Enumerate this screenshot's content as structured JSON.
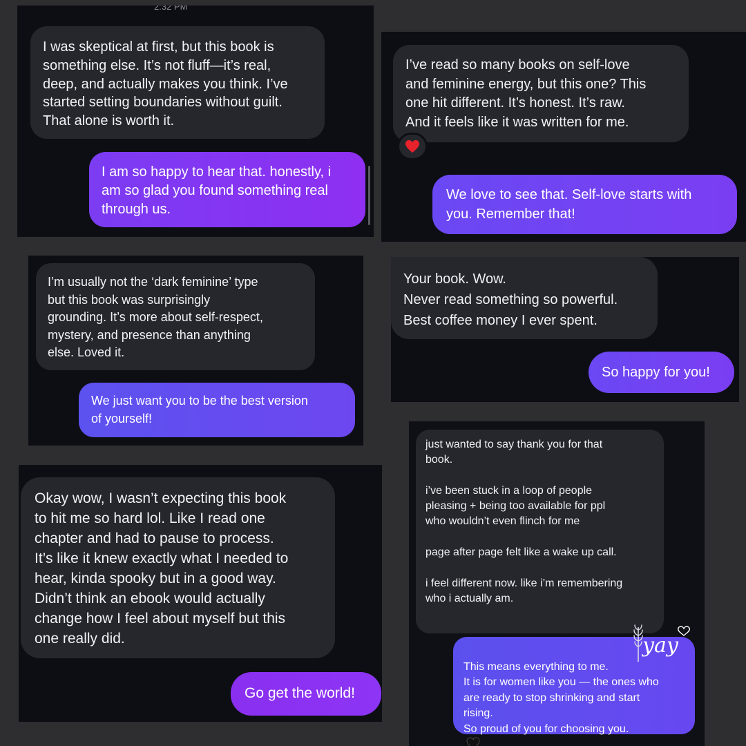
{
  "panel1": {
    "timestamp": "2:32 PM",
    "incoming": "I was skeptical at first, but this book is\nsomething else. It’s not fluff—it’s real,\ndeep, and actually makes you think. I’ve\nstarted setting boundaries without guilt.\nThat alone is worth it.",
    "outgoing": "I am so happy to hear that. honestly, i\nam so glad you found something real\nthrough us."
  },
  "panel2": {
    "incoming": "I’ve read so many books on self-love\nand feminine energy, but this one? This\none hit different. It’s honest. It’s raw.\nAnd it feels like it was written for me.",
    "reaction_icon": "red-heart-icon",
    "outgoing": "We love to see that. Self-love starts with\nyou. Remember that!"
  },
  "panel3": {
    "incoming": "I’m usually not the ‘dark feminine’ type\nbut this book was surprisingly\ngrounding. It’s more about self-respect,\nmystery, and presence than anything\nelse. Loved it.",
    "outgoing": "We just want you to be the best version\nof yourself!"
  },
  "panel4": {
    "incoming": "Your book. Wow.\nNever read something so powerful.\nBest coffee money I ever spent.",
    "outgoing": "So happy for you!"
  },
  "panel5": {
    "incoming": "Okay wow, I wasn’t expecting this book\nto hit me so hard lol. Like I read one\nchapter and had to pause to process.\nIt’s like it knew exactly what I needed to\nhear, kinda spooky but in a good way.\nDidn’t think an ebook would actually\nchange how I feel about myself but this\none really did.",
    "outgoing": "Go get the world!"
  },
  "panel6": {
    "incoming": "just wanted to say thank you for that\nbook.\n\ni’ve been stuck in a loop of people\npleasing + being too available for ppl\nwho wouldn’t even flinch for me\n\npage after page felt like a wake up call.\n\ni feel different now. like i’m remembering\nwho i actually am.",
    "outgoing": "This means everything to me.\nIt is for women like you — the ones who\nare ready to stop shrinking and start\nrising.\nSo proud of you for choosing you.",
    "outgoing_emoji_icon": "black-heart-icon",
    "sticker": "yay"
  },
  "colors": {
    "background": "#2e2e30",
    "panel": "#0d0e13",
    "incoming_bubble": "#26272d",
    "outgoing_bubble": "#7b3cf2"
  }
}
